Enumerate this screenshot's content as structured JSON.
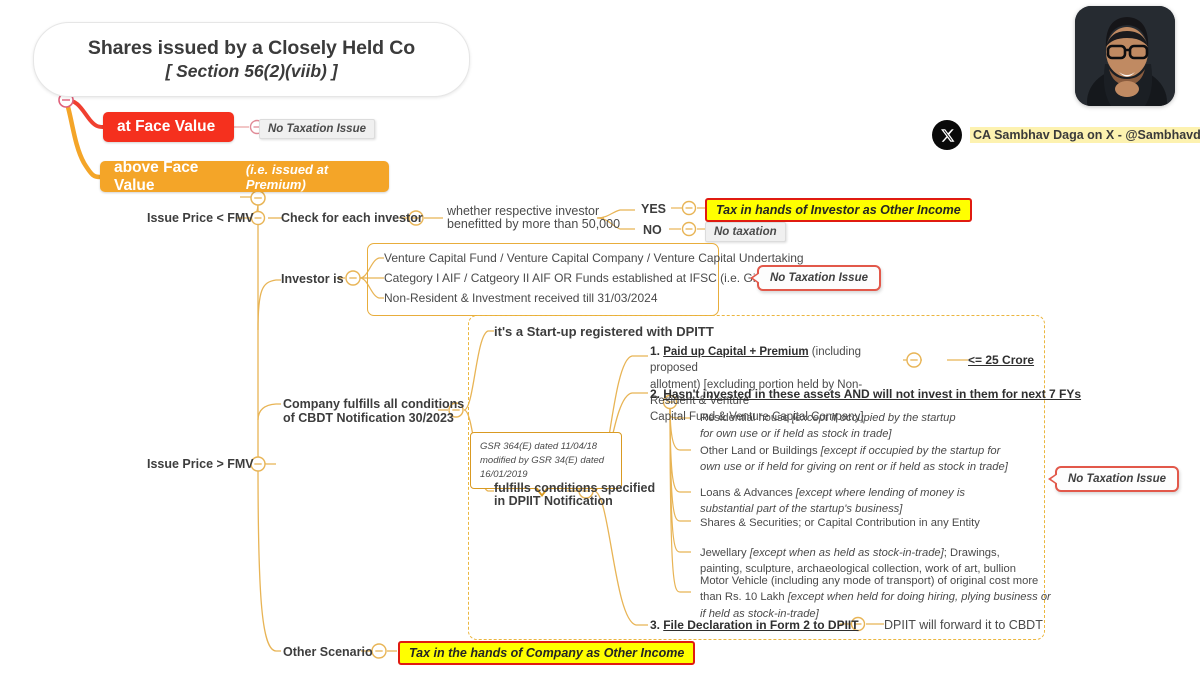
{
  "root": {
    "title_line1": "Shares issued by a Closely Held Co",
    "title_line2": "[ Section 56(2)(viib) ]"
  },
  "branding": {
    "handle": "CA Sambhav Daga on X - @Sambhavdaga",
    "x_icon": "x-logo-icon",
    "avatar": "profile-photo"
  },
  "branches": {
    "face_value": {
      "label": "at Face Value",
      "result": "No Taxation Issue"
    },
    "above_face_value": {
      "label": "above Face Value",
      "sub_label": "(i.e. issued at Premium)"
    }
  },
  "issue_price_below_fmv": {
    "label": "Issue Price < FMV",
    "check": "Check for each investor",
    "question_line1": "whether respective investor",
    "question_line2": "benefitted by more than 50,000",
    "yes_label": "YES",
    "yes_result": "Tax in hands of Investor as Other Income",
    "no_label": "NO",
    "no_result": "No taxation"
  },
  "investor_is": {
    "label": "Investor is",
    "items": [
      "Venture Capital Fund / Venture Capital Company / Venture Capital Undertaking",
      "Category I AIF / Catgeory II AIF OR Funds established at IFSC (i.e. Gift City)",
      "Non-Resident & Investment received till 31/03/2024"
    ],
    "result": "No Taxation Issue"
  },
  "issue_price_above_fmv": {
    "label": "Issue Price > FMV"
  },
  "cbdt": {
    "label_line1": "Company fulfills all conditions",
    "label_line2": "of CBDT Notification 30/2023",
    "startup_heading": "it's a Start-up registered with DPITT",
    "dpiit_line1": "fulfills conditions specified",
    "dpiit_line2": "in DPIIT Notification",
    "gsr_note": "GSR 364(E) dated 11/04/18 modified by GSR 34(E) dated 16/01/2019",
    "result": "No Taxation Issue"
  },
  "conditions": {
    "one": {
      "number": "1.",
      "bold_part": "Paid up Capital + Premium",
      "rest_line1": " (including proposed",
      "rest_line2": "allotment) [excluding portion held by Non-Resident & Venture",
      "rest_line3": "Capital Fund & Venture Capital Company]",
      "limit": "<= 25 Crore"
    },
    "two": {
      "number": "2.",
      "text": "Hasn't invested in these assets AND will not invest in them for next 7 FYs",
      "assets": [
        {
          "plain1": "Residential house ",
          "italic1": "[except if occupied by the startup",
          "italic2": "for own use or if held as stock in trade]"
        },
        {
          "plain1": "Other Land or Buildings ",
          "italic1": "[except if occupied by the startup for",
          "italic2": "own use or if held for giving on rent or if held as stock in trade]"
        },
        {
          "plain1": "Loans & Advances ",
          "italic1": "[except where lending of money is",
          "italic2": "substantial part of the startup's business]"
        },
        {
          "plain1": "Shares & Securities; or Capital Contribution in any Entity",
          "italic1": "",
          "italic2": ""
        },
        {
          "plain1": "Jewellary ",
          "italic1": "[except when as held as stock-in-trade]",
          "plain2": "; Drawings,",
          "italic2": "",
          "plain3": "painting, sculpture, archaeological collection, work of art, bullion"
        },
        {
          "plain1": "Motor Vehicle (including any mode of transport) of original cost more",
          "plain2": "than Rs. 10 Lakh  ",
          "italic1": "[except when held for doing hiring, plying business or",
          "italic2": "if held as stock-in-trade]"
        }
      ]
    },
    "three": {
      "number": "3.",
      "text": "File Declaration in Form 2 to DPIIT",
      "followup": "DPIIT will forward it to CBDT"
    }
  },
  "other_scenario": {
    "label": "Other Scenario",
    "result": "Tax in the hands of Company as Other Income"
  },
  "colors": {
    "red": "#f5301e",
    "orange": "#f4a528",
    "gold": "#e8ad3c",
    "highlight_yellow": "#ffff00",
    "callout_red": "#e2584a"
  }
}
